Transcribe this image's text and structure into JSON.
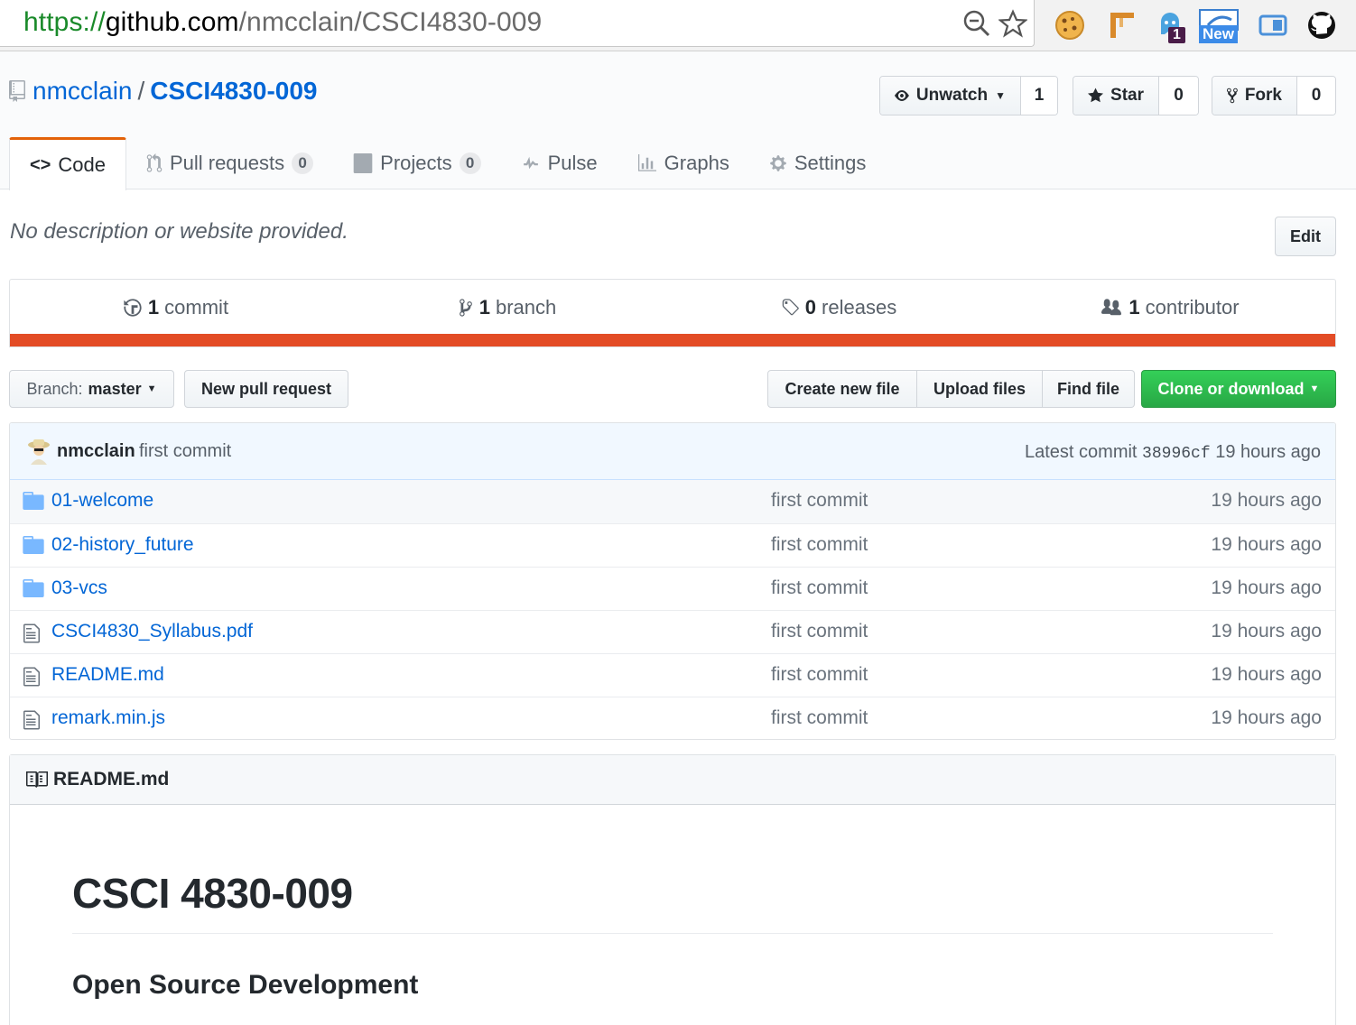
{
  "browser": {
    "url_scheme": "https://",
    "url_host": "github.com",
    "url_path": "/nmcclain/CSCI4830-009",
    "zoom_icon": "zoom-icon",
    "star_icon": "bookmark-star-icon",
    "extensions": [
      {
        "name": "cookie-extension-icon"
      },
      {
        "name": "scrumy-extension-icon"
      },
      {
        "name": "ghostery-extension-icon",
        "badge": "1"
      },
      {
        "name": "new-extension-icon",
        "badge": "New"
      },
      {
        "name": "screen-extension-icon"
      },
      {
        "name": "github-extension-icon"
      }
    ]
  },
  "repo": {
    "owner": "nmcclain",
    "separator": "/",
    "name": "CSCI4830-009",
    "watch": {
      "label": "Unwatch",
      "count": "1"
    },
    "star": {
      "label": "Star",
      "count": "0"
    },
    "fork": {
      "label": "Fork",
      "count": "0"
    }
  },
  "tabs": [
    {
      "label": "Code",
      "icon": "code-icon",
      "selected": true
    },
    {
      "label": "Pull requests",
      "icon": "pull-request-icon",
      "count": "0"
    },
    {
      "label": "Projects",
      "icon": "project-icon",
      "count": "0"
    },
    {
      "label": "Pulse",
      "icon": "pulse-icon"
    },
    {
      "label": "Graphs",
      "icon": "graph-icon"
    },
    {
      "label": "Settings",
      "icon": "gear-icon"
    }
  ],
  "description": {
    "text": "No description or website provided.",
    "edit_label": "Edit"
  },
  "summary": {
    "commits": {
      "num": "1",
      "label": "commit"
    },
    "branches": {
      "num": "1",
      "label": "branch"
    },
    "releases": {
      "num": "0",
      "label": "releases"
    },
    "contributors": {
      "num": "1",
      "label": "contributor"
    },
    "language_color": "#e34c26"
  },
  "file_nav": {
    "branch_prefix": "Branch:",
    "branch_name": "master",
    "new_pr": "New pull request",
    "create_file": "Create new file",
    "upload": "Upload files",
    "find": "Find file",
    "clone": "Clone or download"
  },
  "commit": {
    "author": "nmcclain",
    "message": "first commit",
    "latest_prefix": "Latest commit",
    "sha": "38996cf",
    "age": "19 hours ago"
  },
  "files": [
    {
      "type": "dir",
      "name": "01-welcome",
      "message": "first commit",
      "age": "19 hours ago"
    },
    {
      "type": "dir",
      "name": "02-history_future",
      "message": "first commit",
      "age": "19 hours ago"
    },
    {
      "type": "dir",
      "name": "03-vcs",
      "message": "first commit",
      "age": "19 hours ago"
    },
    {
      "type": "file",
      "name": "CSCI4830_Syllabus.pdf",
      "message": "first commit",
      "age": "19 hours ago"
    },
    {
      "type": "file",
      "name": "README.md",
      "message": "first commit",
      "age": "19 hours ago"
    },
    {
      "type": "file",
      "name": "remark.min.js",
      "message": "first commit",
      "age": "19 hours ago"
    }
  ],
  "readme": {
    "title": "README.md",
    "h1": "CSCI 4830-009",
    "h2": "Open Source Development"
  },
  "colors": {
    "link": "#0366d6",
    "accent_tab": "#e36209",
    "green": "#28a745",
    "folder": "#79b8ff"
  }
}
